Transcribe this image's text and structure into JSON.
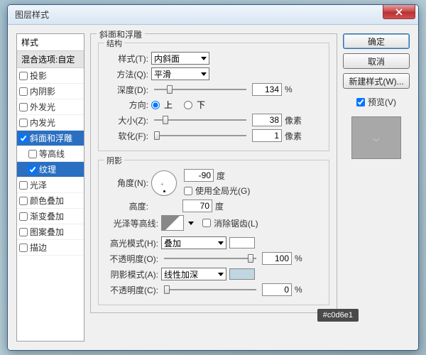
{
  "window": {
    "title": "图层样式"
  },
  "buttons": {
    "ok": "确定",
    "cancel": "取消",
    "newStyle": "新建样式(W)...",
    "preview": "预览(V)"
  },
  "sidebar": {
    "header": "样式",
    "subheader": "混合选项:自定",
    "items": [
      {
        "label": "投影",
        "checked": false
      },
      {
        "label": "内阴影",
        "checked": false
      },
      {
        "label": "外发光",
        "checked": false
      },
      {
        "label": "内发光",
        "checked": false
      },
      {
        "label": "斜面和浮雕",
        "checked": true,
        "selected": false,
        "hl": true
      },
      {
        "label": "等高线",
        "checked": false,
        "indent": true
      },
      {
        "label": "纹理",
        "checked": true,
        "indent": true,
        "selected": true
      },
      {
        "label": "光泽",
        "checked": false
      },
      {
        "label": "颜色叠加",
        "checked": false
      },
      {
        "label": "渐变叠加",
        "checked": false
      },
      {
        "label": "图案叠加",
        "checked": false
      },
      {
        "label": "描边",
        "checked": false
      }
    ]
  },
  "bevel": {
    "group": "斜面和浮雕",
    "structure": "结构",
    "styleLbl": "样式(T):",
    "styleVal": "内斜面",
    "techLbl": "方法(Q):",
    "techVal": "平滑",
    "depthLbl": "深度(D):",
    "depthVal": "134",
    "pct": "%",
    "dirLbl": "方向:",
    "up": "上",
    "down": "下",
    "sizeLbl": "大小(Z):",
    "sizeVal": "38",
    "px": "像素",
    "softLbl": "软化(F):",
    "softVal": "1"
  },
  "shade": {
    "group": "阴影",
    "angleLbl": "角度(N):",
    "angleVal": "-90",
    "deg": "度",
    "globalLbl": "使用全局光(G)",
    "altLbl": "高度:",
    "altVal": "70",
    "glossLbl": "光泽等高线:",
    "antiLbl": "消除锯齿(L)",
    "hiLbl": "高光模式(H):",
    "hiVal": "叠加",
    "opLbl": "不透明度(O):",
    "opVal": "100",
    "shLbl": "阴影模式(A):",
    "shVal": "线性加深",
    "op2Lbl": "不透明度(C):",
    "op2Val": "0"
  },
  "tooltip": "#c0d6e1"
}
